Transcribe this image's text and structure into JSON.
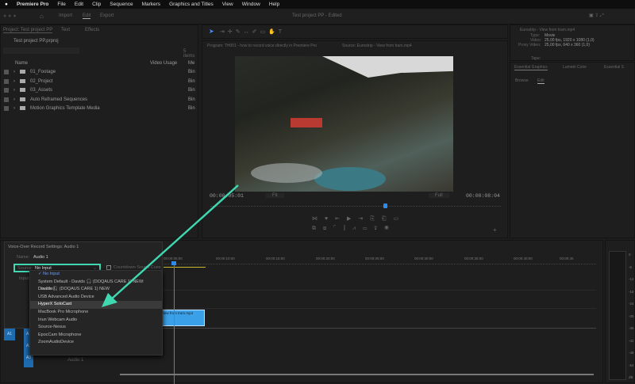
{
  "menu": {
    "apple": "",
    "app": "Premiere Pro",
    "items": [
      "File",
      "Edit",
      "Clip",
      "Sequence",
      "Markers",
      "Graphics and Titles",
      "View",
      "Window",
      "Help"
    ]
  },
  "header": {
    "tabs": [
      "Import",
      "Edit",
      "Export"
    ],
    "active_tab": "Edit",
    "title": "Test project PP - Edited"
  },
  "project": {
    "tabs": [
      "Project: Test project PP",
      "Text",
      "Effects"
    ],
    "file": "Test project PP.prproj",
    "item_count": "5 items",
    "columns": [
      "Name",
      "Video Usage",
      "Me"
    ],
    "items": [
      {
        "name": "01_Footage",
        "type": "Bin"
      },
      {
        "name": "02_Project",
        "type": "Bin"
      },
      {
        "name": "03_Assets",
        "type": "Bin"
      },
      {
        "name": "Auto Reframed Sequences",
        "type": "Bin"
      },
      {
        "name": "Motion Graphics Template Media",
        "type": "Bin"
      }
    ]
  },
  "monitor": {
    "program_label": "Program: TH001 - how to record voice directly in Premiere Pro",
    "source_label": "Source: Eurostrip - View from tram.mp4",
    "timecode_in": "00:00:05:01",
    "timecode_out": "00:00:08:04",
    "fit": "Fit",
    "quality": "Full",
    "playhead_fraction": 0.6
  },
  "info": {
    "clip": "Eurostrip - View from tram.mp4",
    "type_label": "Type:",
    "type": "Movie",
    "video_label": "Video:",
    "video": "25,00 fps, 1920 x 1080 (1,0)",
    "proxy_label": "Proxy Video:",
    "proxy": "25,00 fps, 640 x 360 (1,0)",
    "tape_label": "Tape:"
  },
  "eg": {
    "tabs": [
      "Essential Graphics",
      "Lumetri Color",
      "Essential S"
    ],
    "subtabs": [
      "Browse",
      "Edit"
    ]
  },
  "voiceover": {
    "title": "Voice-Over Record Settings: Audio 1",
    "name_label": "Name:",
    "name": "Audio 1",
    "source_label": "Source:",
    "source": "No Input",
    "countdown": "Countdown Sound Cues",
    "input_label": "Input:",
    "options": [
      "No Input",
      "System Default - Davids 🎧 (DOQAUS CARE 1) NEW: Disabled",
      "Davids 🎧 (DOQAUS CARE 1) NEW",
      "USB Advanced Audio Device",
      "HyperX SoloCast",
      "MacBook Pro Microphone",
      "Iriun Webcam Audio",
      "Source-Nexus",
      "EpocCam Microphone",
      "ZoomAudioDevice"
    ],
    "selected": "No Input",
    "hovered": "HyperX SoloCast"
  },
  "timeline": {
    "ruler": [
      "00:00:05:00",
      "00:00:10:00",
      "00:00:15:00",
      "00:00:20:00",
      "00:00:25:00",
      "00:00:30:00",
      "00:00:35:00",
      "00:00:40:00",
      "00:00:45"
    ],
    "clip": "View from tram.mp4",
    "tracks": [
      "A1",
      "A2",
      "A3"
    ],
    "track_name": "Audio 1"
  },
  "meter": {
    "labels": [
      "0",
      "-6",
      "-12",
      "-18",
      "-24",
      "-30",
      "-36",
      "-42",
      "-48",
      "-54",
      "dB"
    ]
  },
  "colors": {
    "accent": "#2d8ceb",
    "highlight": "#3fd8b0",
    "clip": "#3aa0e8"
  }
}
